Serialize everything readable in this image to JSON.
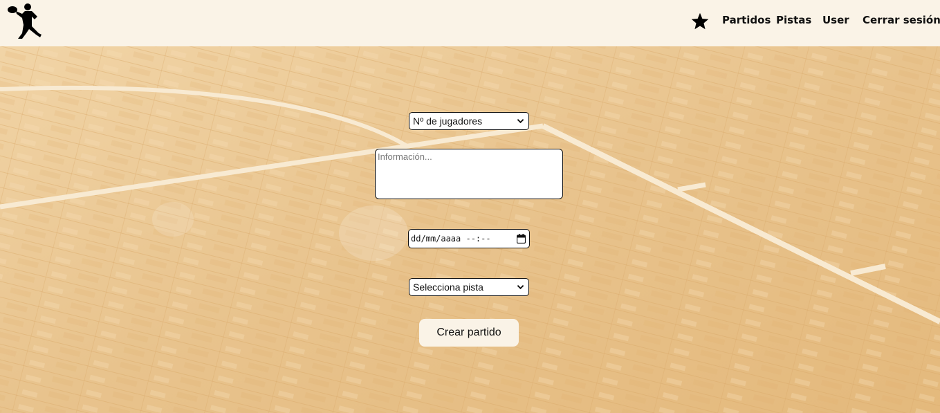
{
  "navbar": {
    "logo_icon": "padel-player-silhouette-icon",
    "favorites_icon": "star-icon",
    "items": [
      {
        "label": "Partidos"
      },
      {
        "label": "Pistas"
      },
      {
        "label": "User"
      },
      {
        "label": "Cerrar sesión"
      }
    ]
  },
  "form": {
    "players_select": {
      "value": "Nº de jugadores"
    },
    "info_textarea": {
      "placeholder": "Información..."
    },
    "datetime_input": {
      "value": "dd/mm/aaaa  --:--",
      "icon": "calendar-icon"
    },
    "court_select": {
      "value": "Selecciona pista"
    },
    "submit_label": "Crear partido"
  },
  "colors": {
    "navbar_bg": "#faf3e7",
    "floor_wood": "#e9c48f",
    "button_bg": "#faf3e7"
  }
}
